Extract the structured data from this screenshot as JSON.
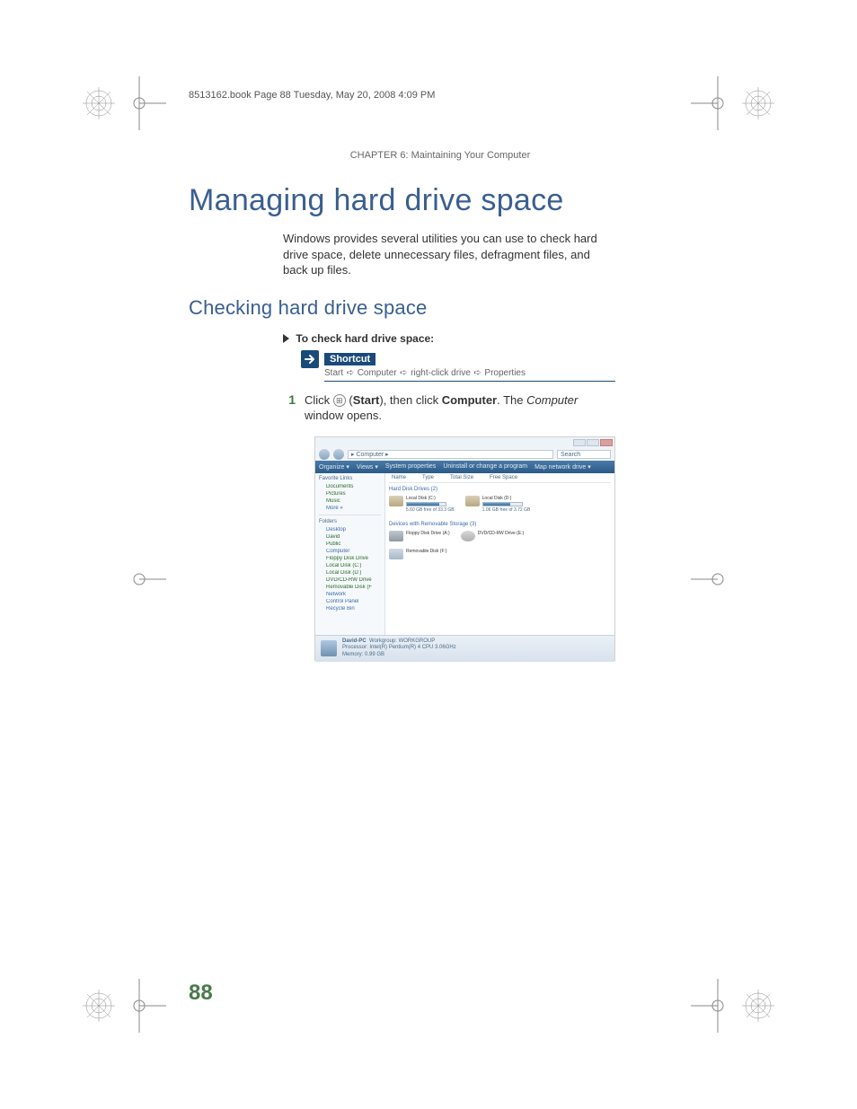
{
  "book_header": "8513162.book  Page 88  Tuesday, May 20, 2008  4:09 PM",
  "chapter_header": "CHAPTER 6: Maintaining Your Computer",
  "h1": "Managing hard drive space",
  "intro": "Windows provides several utilities you can use to check hard drive space, delete unnecessary files, defragment files, and back up files.",
  "h2": "Checking hard drive space",
  "step_heading": "To check hard drive space:",
  "shortcut": {
    "title": "Shortcut",
    "crumbs": [
      "Start",
      "Computer",
      "right-click drive",
      "Properties"
    ]
  },
  "step1": {
    "num": "1",
    "prefix": "Click ",
    "start": "Start",
    "mid1": " (",
    "mid2": "), then click ",
    "computer": "Computer",
    "mid3": ". The ",
    "computer_italic": "Computer",
    "suffix": " window opens."
  },
  "screenshot": {
    "breadcrumb": "▸ Computer ▸",
    "search": "Search",
    "toolbar": [
      "Organize ▾",
      "Views ▾",
      "System properties",
      "Uninstall or change a program",
      "Map network drive ▾"
    ],
    "nav": {
      "fav_hdr": "Favorite Links",
      "fav_items": [
        "Documents",
        "Pictures",
        "Music",
        "More »"
      ],
      "fold_hdr": "Folders",
      "fold_items": [
        "Desktop",
        "David",
        "Public",
        "Computer",
        "Floppy Disk Drive",
        "Local Disk (C:)",
        "Local Disk (D:)",
        "DVD/CD-RW Drive",
        "Removable Disk (F",
        "Network",
        "Control Panel",
        "Recycle Bin"
      ]
    },
    "cols": [
      "Name",
      "Type",
      "Total Size",
      "Free Space"
    ],
    "group_hdd": "Hard Disk Drives (2)",
    "drive_c": {
      "name": "Local Disk (C:)",
      "free": "5.60 GB free of 33.3 GB",
      "fill": 83
    },
    "drive_d": {
      "name": "Local Disk (D:)",
      "free": "1.06 GB free of 3.72 GB",
      "fill": 71
    },
    "group_rem": "Devices with Removable Storage (3)",
    "drive_a": {
      "name": "Floppy Disk Drive (A:)"
    },
    "drive_e": {
      "name": "DVD/CD-RW Drive (E:)"
    },
    "drive_f": {
      "name": "Removable Disk (F:)"
    },
    "status": {
      "name": "David-PC",
      "workgroup_label": "Workgroup:",
      "workgroup": "WORKGROUP",
      "proc_label": "Processor:",
      "proc": "Intel(R) Pentium(R) 4 CPU 3.06GHz",
      "mem_label": "Memory:",
      "mem": "0.99 GB"
    }
  },
  "page_num": "88"
}
